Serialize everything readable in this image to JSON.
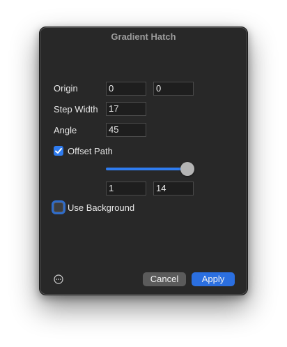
{
  "dialog": {
    "title": "Gradient Hatch",
    "origin": {
      "label": "Origin",
      "x": "0",
      "y": "0"
    },
    "step_width": {
      "label": "Step Width",
      "value": "17"
    },
    "angle": {
      "label": "Angle",
      "value": "45"
    },
    "offset_path": {
      "label": "Offset Path",
      "checked": true,
      "slider_fraction": 1.0,
      "start": "1",
      "end": "14"
    },
    "use_background": {
      "label": "Use Background",
      "checked": false
    },
    "buttons": {
      "cancel": "Cancel",
      "apply": "Apply"
    },
    "icons": {
      "more": "ellipsis-circle-icon",
      "check": "checkmark-icon"
    },
    "colors": {
      "accent": "#2f7cf0",
      "background": "#282828"
    }
  }
}
